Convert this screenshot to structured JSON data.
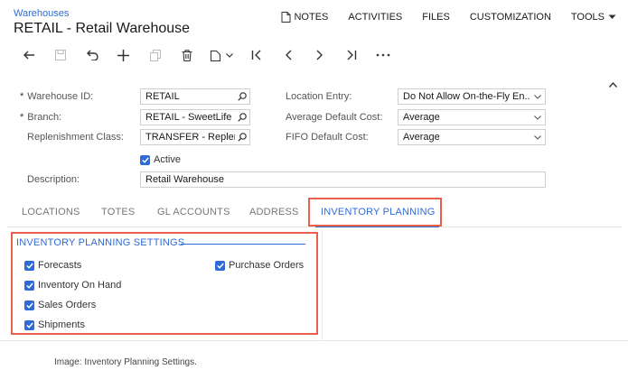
{
  "header": {
    "breadcrumb": "Warehouses",
    "title": "RETAIL - Retail Warehouse",
    "menu": [
      "NOTES",
      "ACTIVITIES",
      "FILES",
      "CUSTOMIZATION",
      "TOOLS"
    ]
  },
  "toolbar": {
    "icons": [
      "back-icon",
      "save-icon",
      "undo-icon",
      "add-icon",
      "copy-icon",
      "delete-icon",
      "clipboard-icon",
      "first-record-icon",
      "previous-record-icon",
      "next-record-icon",
      "last-record-icon",
      "more-icon"
    ]
  },
  "form": {
    "warehouse_id_label": "Warehouse ID:",
    "warehouse_id_value": "RETAIL",
    "branch_label": "Branch:",
    "branch_value": "RETAIL - SweetLife S",
    "replenishment_class_label": "Replenishment Class:",
    "replenishment_class_value": "TRANSFER - Repler",
    "active_label": "Active",
    "description_label": "Description:",
    "description_value": "Retail Warehouse",
    "location_entry_label": "Location Entry:",
    "location_entry_value": "Do Not Allow On-the-Fly En...",
    "avg_cost_label": "Average Default Cost:",
    "avg_cost_value": "Average",
    "fifo_cost_label": "FIFO Default Cost:",
    "fifo_cost_value": "Average",
    "required_marker": "*"
  },
  "tabs": [
    "LOCATIONS",
    "TOTES",
    "GL ACCOUNTS",
    "ADDRESS",
    "INVENTORY PLANNING"
  ],
  "planning": {
    "section_title": "INVENTORY PLANNING SETTINGS",
    "forecasts": "Forecasts",
    "inventory_on_hand": "Inventory On Hand",
    "sales_orders": "Sales Orders",
    "shipments": "Shipments",
    "purchase_orders": "Purchase Orders"
  },
  "caption": "Image: Inventory Planning Settings.",
  "colors": {
    "accent": "#2f6bd8",
    "highlight": "#e8604c"
  }
}
